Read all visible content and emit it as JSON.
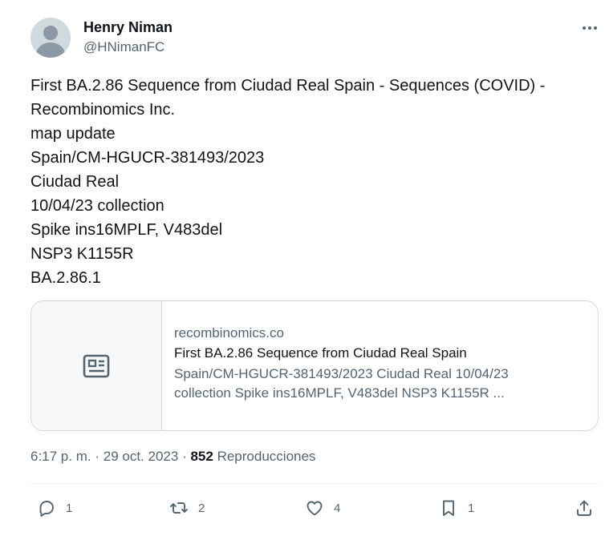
{
  "author": {
    "name": "Henry Niman",
    "handle": "@HNimanFC",
    "avatar_icon": "default-avatar-icon"
  },
  "tweet": {
    "lines": [
      "First BA.2.86 Sequence from Ciudad Real Spain - Sequences (COVID) -",
      "Recombinomics Inc.",
      "map update",
      "Spain/CM-HGUCR-381493/2023",
      "Ciudad Real",
      "10/04/23 collection",
      "Spike ins16MPLF, V483del",
      "NSP3 K1155R",
      "BA.2.86.1"
    ]
  },
  "card": {
    "icon": "article-icon",
    "domain": "recombinomics.co",
    "title": "First BA.2.86 Sequence from Ciudad Real Spain",
    "description_lines": [
      "Spain/CM-HGUCR-381493/2023 Ciudad Real 10/04/23",
      "collection Spike ins16MPLF, V483del NSP3 K1155R ..."
    ]
  },
  "meta": {
    "time": "6:17 p. m.",
    "separator": "·",
    "date": "29 oct. 2023",
    "views_count": "852",
    "views_label": "Reproducciones"
  },
  "actions": {
    "reply": {
      "icon": "reply-icon",
      "count": "1"
    },
    "repost": {
      "icon": "repost-icon",
      "count": "2"
    },
    "like": {
      "icon": "heart-icon",
      "count": "4"
    },
    "bookmark": {
      "icon": "bookmark-icon",
      "count": "1"
    },
    "share": {
      "icon": "share-icon"
    }
  },
  "colors": {
    "text_primary": "#0f1419",
    "text_secondary": "#536471",
    "border": "#cfd9de"
  }
}
